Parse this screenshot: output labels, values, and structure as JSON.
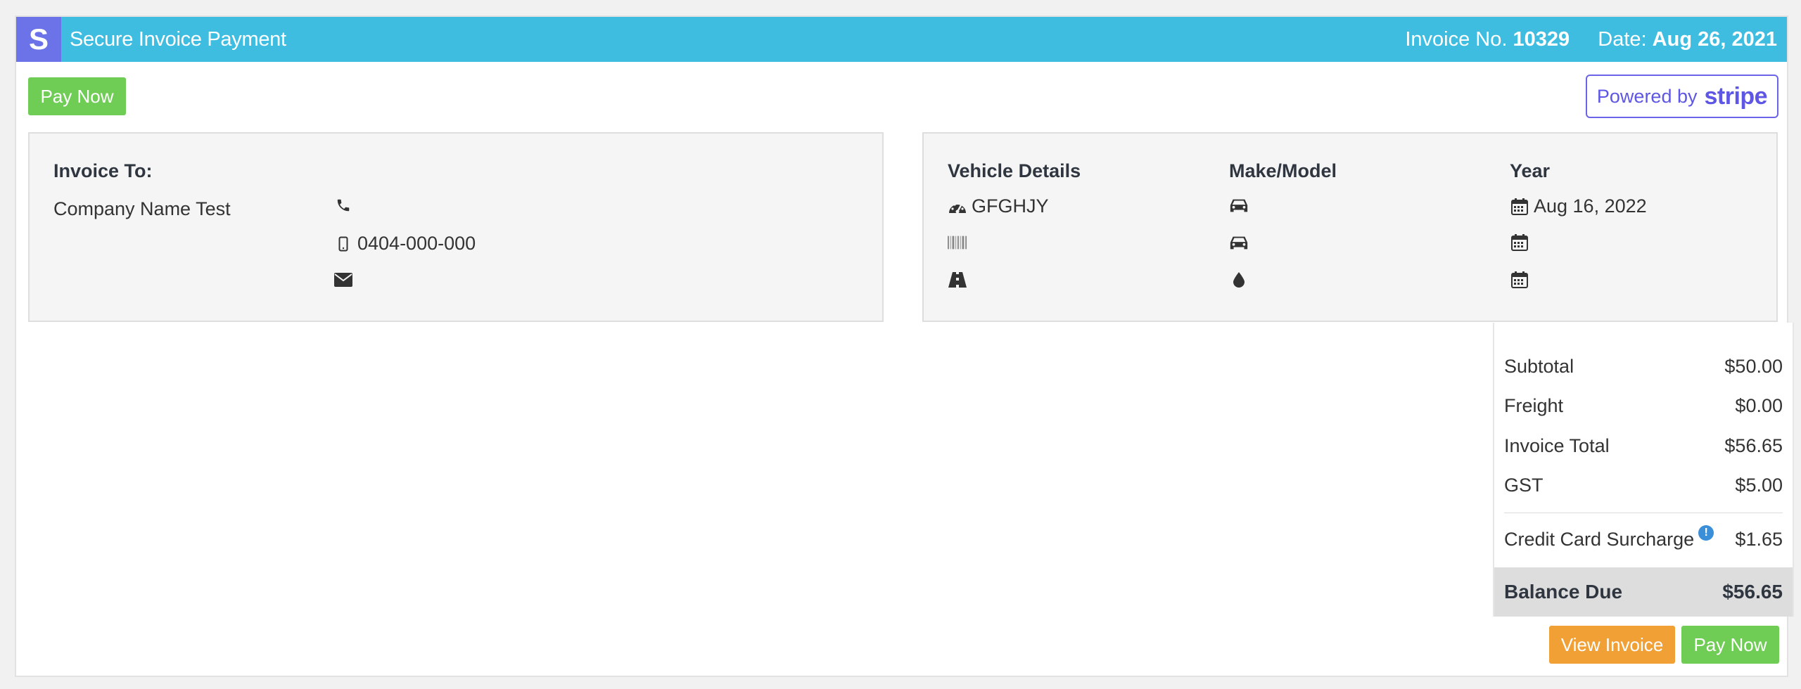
{
  "header": {
    "logo_letter": "S",
    "title": "Secure Invoice Payment",
    "invoice_label": "Invoice No.",
    "invoice_number": "10329",
    "date_label": "Date:",
    "date_value": "Aug 26, 2021"
  },
  "actions": {
    "pay_now_top": "Pay Now",
    "view_invoice": "View Invoice",
    "pay_now_bottom": "Pay Now"
  },
  "stripe": {
    "powered_by": "Powered by",
    "brand": "stripe"
  },
  "invoice_to": {
    "heading": "Invoice To:",
    "company": "Company Name Test",
    "phone": "",
    "mobile": "0404-000-000",
    "email": ""
  },
  "vehicle": {
    "col_details": "Vehicle Details",
    "col_make_model": "Make/Model",
    "col_year": "Year",
    "rego": "GFGHJY",
    "vin": "",
    "odometer": "",
    "make": "",
    "model": "",
    "fuel": "",
    "year_date_1": "Aug 16, 2022",
    "year_date_2": "",
    "year_date_3": ""
  },
  "totals": {
    "subtotal_label": "Subtotal",
    "subtotal_value": "$50.00",
    "freight_label": "Freight",
    "freight_value": "$0.00",
    "invoice_total_label": "Invoice Total",
    "invoice_total_value": "$56.65",
    "gst_label": "GST",
    "gst_value": "$5.00",
    "surcharge_label": "Credit Card Surcharge",
    "surcharge_value": "$1.65",
    "balance_label": "Balance Due",
    "balance_value": "$56.65"
  },
  "colors": {
    "header_bg": "#3fbde0",
    "logo_bg": "#6c72e8",
    "green": "#6fcc54",
    "orange": "#f0a035",
    "stripe_purple": "#5e56e4"
  },
  "icons": [
    "phone-icon",
    "mobile-icon",
    "envelope-icon",
    "dashboard-icon",
    "barcode-icon",
    "road-icon",
    "car-icon",
    "droplet-icon",
    "calendar-icon",
    "info-icon"
  ]
}
